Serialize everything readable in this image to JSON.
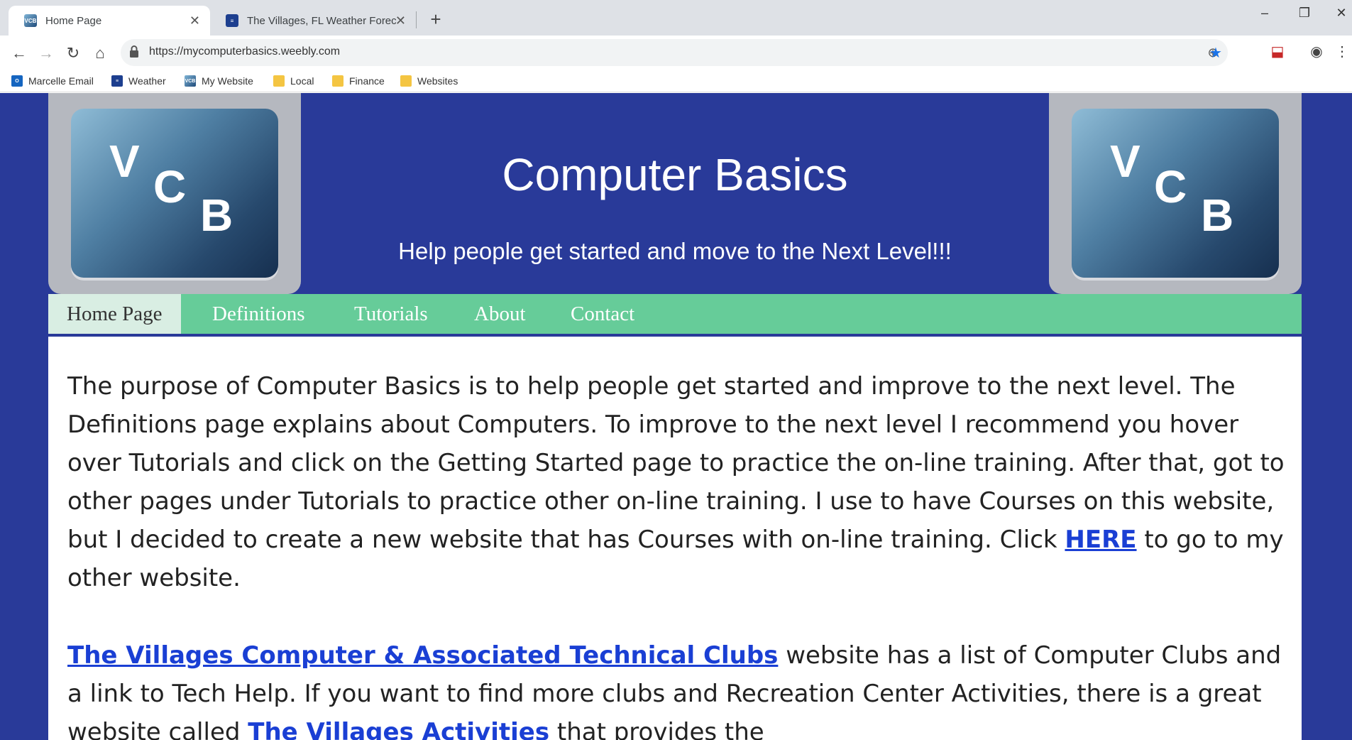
{
  "browser": {
    "tabs": [
      {
        "title": "Home Page",
        "favicon": "vcb-logo-icon",
        "active": true
      },
      {
        "title": "The Villages, FL Weather Forecas",
        "favicon": "weather-icon",
        "active": false
      }
    ],
    "new_tab_label": "+",
    "window_controls": {
      "minimize": "–",
      "restore": "❐",
      "close": "✕"
    },
    "url": "https://mycomputerbasics.weebly.com",
    "bookmarks": [
      {
        "label": "Marcelle Email",
        "icon": "outlook-icon"
      },
      {
        "label": "Weather",
        "icon": "weather-icon"
      },
      {
        "label": "My Website",
        "icon": "vcb-logo-icon"
      },
      {
        "label": "Local",
        "icon": "folder-icon"
      },
      {
        "label": "Finance",
        "icon": "folder-icon"
      },
      {
        "label": "Websites",
        "icon": "folder-icon"
      }
    ]
  },
  "site": {
    "logo_letters": {
      "v": "V",
      "c": "C",
      "b": "B"
    },
    "title": "Computer Basics",
    "tagline": "Help people get started and move to the Next Level!!!",
    "nav": [
      {
        "label": "Home Page",
        "active": true
      },
      {
        "label": "Definitions",
        "active": false
      },
      {
        "label": "Tutorials",
        "active": false
      },
      {
        "label": "About",
        "active": false
      },
      {
        "label": "Contact",
        "active": false
      }
    ],
    "paragraph1": {
      "text_before_link": "The purpose of Computer Basics is to help people get started and improve to the next level. The Definitions page explains about Computers.  To improve to the next level I recommend you hover over Tutorials and click on the Getting Started page to practice the on-line training.  After that, got to other pages under Tutorials to practice other on-line training.  I use to have Courses on this website, but I decided to create a new website that has Courses with on-line training.  Click ",
      "link_text": "HERE",
      "text_after_link": " to go to my other website."
    },
    "paragraph2": {
      "link1_text": "The Villages Computer & Associated Technical Clubs",
      "text_middle": " website has a list of Computer Clubs and a link to Tech Help.  If you want to find more clubs and Recreation Center Activities, there is a great website called ",
      "link2_text": "The Villages Activities",
      "text_end": " that provides the"
    }
  },
  "colors": {
    "page_background": "#293a99",
    "nav_background": "#66cc99",
    "nav_active_background": "#d9eee3",
    "link": "#1a3fd4",
    "logo_frame": "#b5b8bf"
  }
}
